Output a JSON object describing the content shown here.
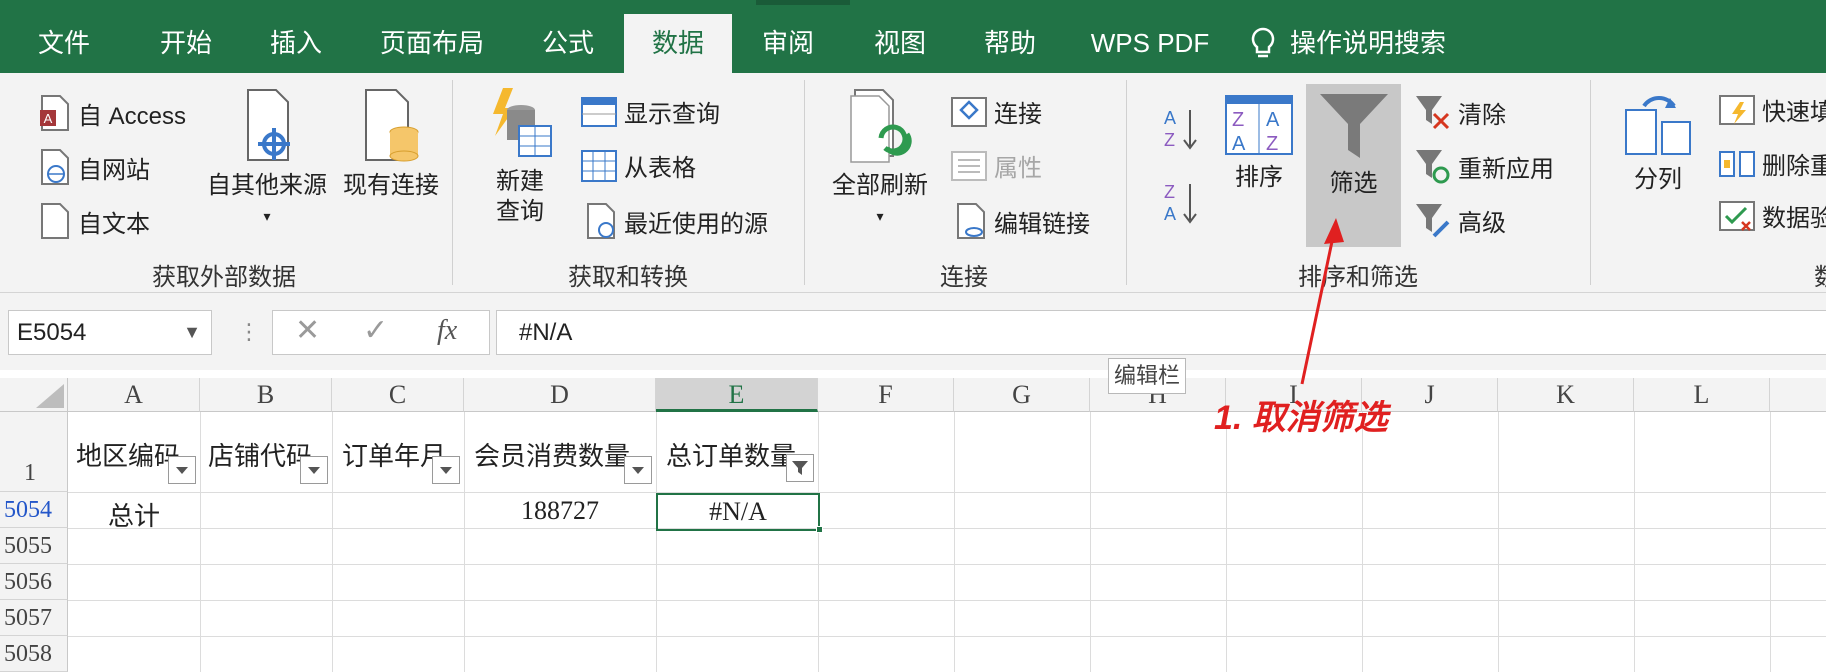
{
  "tabs": [
    {
      "label": "文件"
    },
    {
      "label": "开始"
    },
    {
      "label": "插入"
    },
    {
      "label": "页面布局"
    },
    {
      "label": "公式"
    },
    {
      "label": "数据"
    },
    {
      "label": "审阅"
    },
    {
      "label": "视图"
    },
    {
      "label": "帮助"
    },
    {
      "label": "WPS PDF"
    },
    {
      "label": "操作说明搜索"
    }
  ],
  "active_tab": "数据",
  "ribbon": {
    "group_external": {
      "label": "获取外部数据",
      "from_access": "自 Access",
      "from_web": "自网站",
      "from_text": "自文本",
      "other_sources": "自其他来源",
      "existing_conn": "现有连接"
    },
    "group_transform": {
      "label": "获取和转换",
      "new_query_1": "新建",
      "new_query_2": "查询",
      "show_queries": "显示查询",
      "from_table": "从表格",
      "recent_sources": "最近使用的源"
    },
    "group_connections": {
      "label": "连接",
      "refresh_all": "全部刷新",
      "connections": "连接",
      "properties": "属性",
      "edit_links": "编辑链接"
    },
    "group_sort": {
      "label": "排序和筛选",
      "sort": "排序",
      "filter": "筛选",
      "clear": "清除",
      "reapply": "重新应用",
      "advanced": "高级"
    },
    "group_tools": {
      "label": "数",
      "split": "分列",
      "flash_fill": "快速填",
      "remove_dup": "删除重",
      "validation": "数据验"
    }
  },
  "formula_bar": {
    "name_box": "E5054",
    "fx": "fx",
    "value": "#N/A",
    "tooltip": "编辑栏"
  },
  "grid": {
    "columns": [
      "A",
      "B",
      "C",
      "D",
      "E",
      "F",
      "G",
      "H",
      "I",
      "J",
      "K",
      "L"
    ],
    "selected_column": "E",
    "header_row": {
      "row_num": "1",
      "cells": [
        "地区编码",
        "店铺代码",
        "订单年月",
        "会员消费数量",
        "总订单数量"
      ]
    },
    "rows": [
      {
        "row_num": "5054",
        "A": "总计",
        "D": "188727",
        "E": "#N/A"
      },
      {
        "row_num": "5055"
      },
      {
        "row_num": "5056"
      },
      {
        "row_num": "5057"
      },
      {
        "row_num": "5058"
      }
    ]
  },
  "annotation": "1. 取消筛选",
  "colors": {
    "accent": "#217346",
    "annotation": "#e02020"
  }
}
